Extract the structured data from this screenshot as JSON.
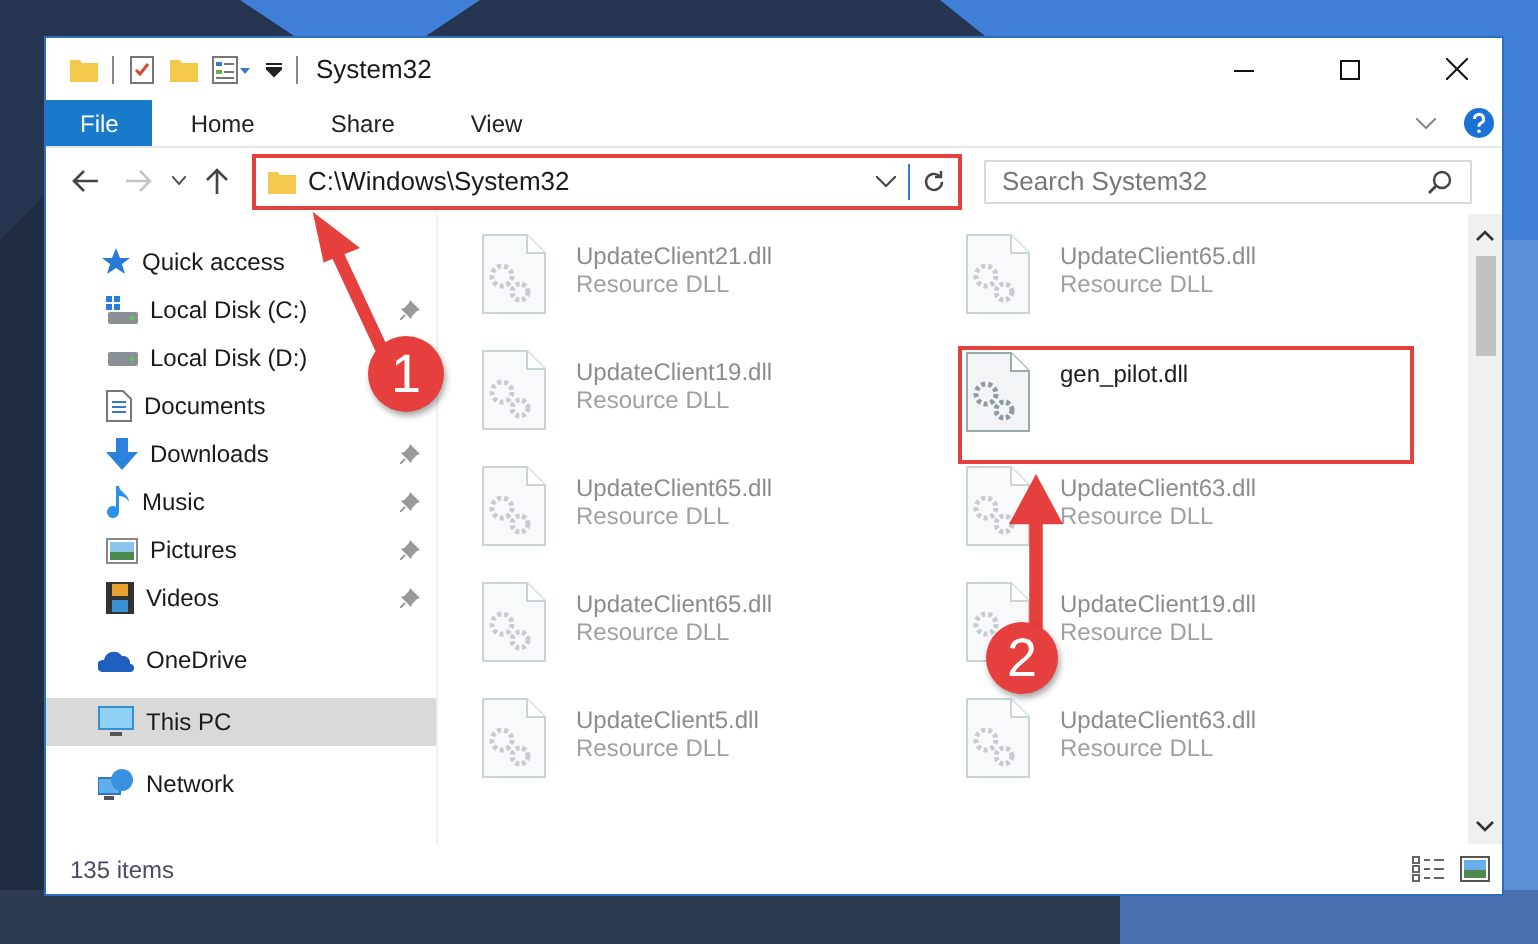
{
  "window": {
    "title": "System32"
  },
  "ribbon": {
    "tabs": [
      {
        "label": "File",
        "selected": true
      },
      {
        "label": "Home",
        "selected": false
      },
      {
        "label": "Share",
        "selected": false
      },
      {
        "label": "View",
        "selected": false
      }
    ]
  },
  "address_bar": {
    "path": "C:\\Windows\\System32",
    "highlighted": true
  },
  "search": {
    "placeholder": "Search System32"
  },
  "nav": [
    {
      "label": "Quick access",
      "kind": "star",
      "selected": false,
      "children": [
        {
          "label": "Local Disk (C:)",
          "kind": "disk-c",
          "pinned": true
        },
        {
          "label": "Local Disk (D:)",
          "kind": "disk",
          "pinned": false
        },
        {
          "label": "Documents",
          "kind": "documents",
          "pinned": false
        },
        {
          "label": "Downloads",
          "kind": "downloads",
          "pinned": true
        },
        {
          "label": "Music",
          "kind": "music",
          "pinned": true
        },
        {
          "label": "Pictures",
          "kind": "pictures",
          "pinned": true
        },
        {
          "label": "Videos",
          "kind": "videos",
          "pinned": true
        }
      ]
    },
    {
      "label": "OneDrive",
      "kind": "cloud",
      "selected": false
    },
    {
      "label": "This PC",
      "kind": "pc",
      "selected": true
    },
    {
      "label": "Network",
      "kind": "network",
      "selected": false
    }
  ],
  "files": [
    {
      "name": "UpdateClient21.dll",
      "type": "Resource DLL",
      "blurred": true
    },
    {
      "name": "UpdateClient65.dll",
      "type": "Resource DLL",
      "blurred": true
    },
    {
      "name": "UpdateClient19.dll",
      "type": "Resource DLL",
      "blurred": true
    },
    {
      "name": "gen_pilot.dll",
      "blurred": false,
      "highlighted": true
    },
    {
      "name": "UpdateClient65.dll",
      "type": "Resource DLL",
      "blurred": true
    },
    {
      "name": "UpdateClient63.dll",
      "type": "Resource DLL",
      "blurred": true
    },
    {
      "name": "UpdateClient65.dll",
      "type": "Resource DLL",
      "blurred": true
    },
    {
      "name": "UpdateClient19.dll",
      "type": "Resource DLL",
      "blurred": true
    },
    {
      "name": "UpdateClient5.dll",
      "type": "Resource DLL",
      "blurred": true
    },
    {
      "name": "UpdateClient63.dll",
      "type": "Resource DLL",
      "blurred": true
    }
  ],
  "status_bar": {
    "item_count": "135 items"
  },
  "annotations": [
    {
      "label": "1"
    },
    {
      "label": "2"
    }
  ]
}
